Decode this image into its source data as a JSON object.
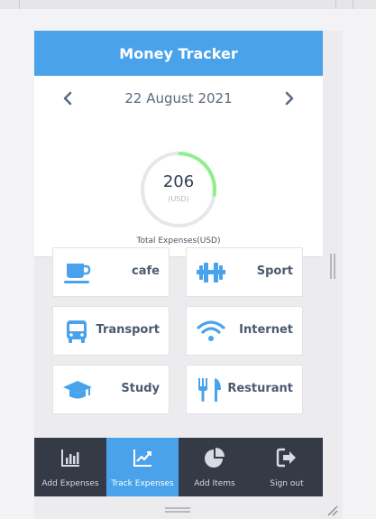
{
  "app": {
    "title": "Money Tracker"
  },
  "summary": {
    "date": "22 August 2021",
    "total": "206",
    "currency": "(USD)",
    "total_label": "Total Expenses(USD)",
    "progress_fraction": 0.28
  },
  "categories": [
    {
      "label": "cafe",
      "icon": "coffee-cup-icon"
    },
    {
      "label": "Sport",
      "icon": "dumbbell-icon"
    },
    {
      "label": "Transport",
      "icon": "bus-icon"
    },
    {
      "label": "Internet",
      "icon": "wifi-icon"
    },
    {
      "label": "Study",
      "icon": "graduation-cap-icon"
    },
    {
      "label": "Resturant",
      "icon": "fork-knife-icon"
    }
  ],
  "tabs": [
    {
      "label": "Add Expenses",
      "icon": "bar-chart-icon",
      "active": false
    },
    {
      "label": "Track Expenses",
      "icon": "line-chart-icon",
      "active": true
    },
    {
      "label": "Add Items",
      "icon": "pie-chart-icon",
      "active": false
    },
    {
      "label": "Sign out",
      "icon": "sign-out-icon",
      "active": false
    }
  ],
  "colors": {
    "accent": "#4aa3ea",
    "gauge_fill": "#8ef08a",
    "gauge_track": "#e7e7ea",
    "tabbar": "#343a46"
  }
}
